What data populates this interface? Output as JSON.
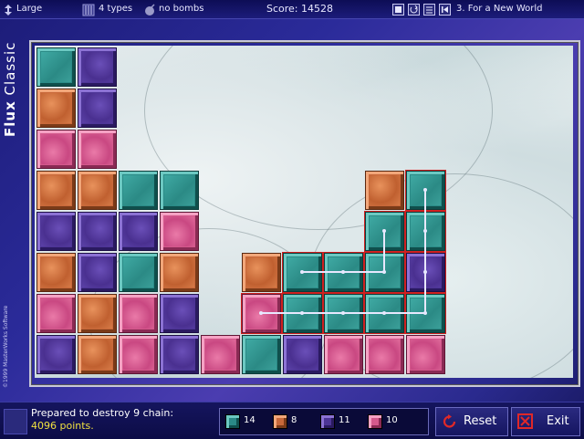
{
  "topbar": {
    "size_label": "Large",
    "types_label": "4 types",
    "bombs_label": "no bombs",
    "score_text": "Score: 14528",
    "track_text": "3. For a New World"
  },
  "side": {
    "title_bold": "Flux",
    "title_rest": " Classic",
    "copyright": "©1999 MasterWorks Software"
  },
  "colors": {
    "teal": "#2a8a86",
    "orange": "#c8683a",
    "purple": "#4d3596",
    "pink": "#d4598c",
    "chain": "#e8e8ff"
  },
  "board": {
    "columns": 13,
    "rows": 8,
    "grid": [
      [
        "teal",
        "purple",
        null,
        null,
        null,
        null,
        null,
        null,
        null,
        null,
        null,
        null,
        null
      ],
      [
        "orange",
        "purple",
        null,
        null,
        null,
        null,
        null,
        null,
        null,
        null,
        null,
        null,
        null
      ],
      [
        "pink",
        "pink",
        null,
        null,
        null,
        null,
        null,
        null,
        null,
        null,
        null,
        null,
        null
      ],
      [
        "orange",
        "orange",
        "teal",
        "teal",
        null,
        null,
        null,
        null,
        "orange",
        "teal",
        null,
        null,
        null
      ],
      [
        "purple",
        "purple",
        "purple",
        "pink",
        null,
        null,
        null,
        null,
        "teal",
        "teal",
        null,
        null,
        null
      ],
      [
        "orange",
        "purple",
        "teal",
        "orange",
        null,
        "orange",
        "teal",
        "teal",
        "teal",
        "purple",
        null,
        null,
        null
      ],
      [
        "pink",
        "orange",
        "pink",
        "purple",
        null,
        "pink",
        "teal",
        "teal",
        "teal",
        "teal",
        null,
        null,
        null
      ],
      [
        "purple",
        "orange",
        "pink",
        "purple",
        "pink",
        "teal",
        "purple",
        "pink",
        "pink",
        "pink",
        null,
        null,
        null
      ]
    ],
    "chain": [
      [
        6,
        5
      ],
      [
        6,
        6
      ],
      [
        6,
        7
      ],
      [
        6,
        8
      ],
      [
        6,
        9
      ],
      [
        5,
        9
      ],
      [
        4,
        9
      ],
      [
        3,
        9
      ],
      [
        4,
        8
      ],
      [
        5,
        8
      ],
      [
        5,
        7
      ],
      [
        5,
        6
      ]
    ]
  },
  "status": {
    "line1": "Prepared to destroy 9 chain:",
    "line2": "4096 points."
  },
  "counts": [
    {
      "color": "teal",
      "value": "14"
    },
    {
      "color": "orange",
      "value": "8"
    },
    {
      "color": "purple",
      "value": "11"
    },
    {
      "color": "pink",
      "value": "10"
    }
  ],
  "buttons": {
    "reset": "Reset",
    "exit": "Exit"
  }
}
